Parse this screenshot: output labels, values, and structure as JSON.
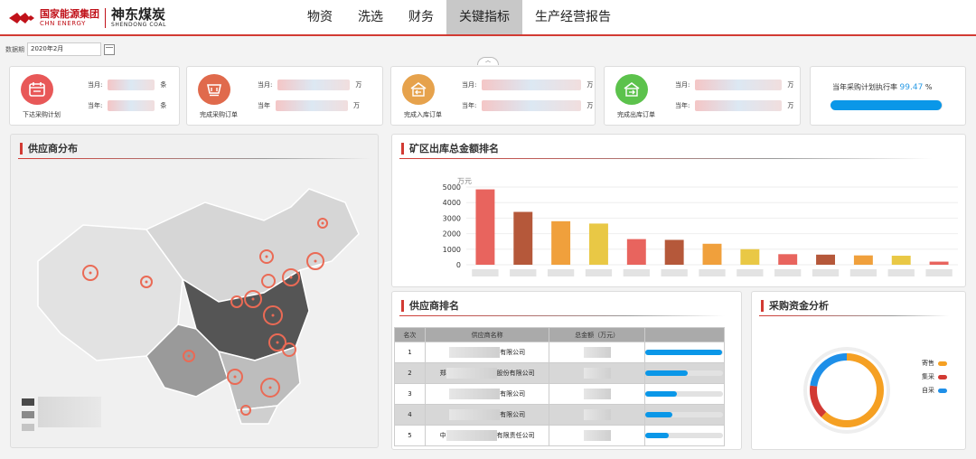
{
  "brand": {
    "cn1": "国家能源集团",
    "en1": "CHN ENERGY",
    "cn2": "神东煤炭",
    "en2": "SHENDONG COAL"
  },
  "nav": [
    {
      "label": "物资",
      "active": false
    },
    {
      "label": "洗选",
      "active": false
    },
    {
      "label": "财务",
      "active": false
    },
    {
      "label": "关键指标",
      "active": true
    },
    {
      "label": "生产经营报告",
      "active": false
    }
  ],
  "date_filter": {
    "label": "数据期",
    "value": "2020年2月"
  },
  "kpis": [
    {
      "caption": "下达采购计划",
      "row1_label": "当月:",
      "row1_unit": "条",
      "row2_label": "当年:",
      "row2_unit": "条",
      "color": "#e85858",
      "icon": "calendar-icon"
    },
    {
      "caption": "完成采购订单",
      "row1_label": "当月:",
      "row1_unit": "万",
      "row2_label": "当年",
      "row2_unit": "万",
      "color": "#e06a4c",
      "icon": "cart-icon"
    },
    {
      "caption": "完成入库订单",
      "row1_label": "当月:",
      "row1_unit": "万",
      "row2_label": "当年:",
      "row2_unit": "万",
      "color": "#e6a24c",
      "icon": "warehouse-in-icon"
    },
    {
      "caption": "完成出库订单",
      "row1_label": "当月:",
      "row1_unit": "万",
      "row2_label": "当年:",
      "row2_unit": "万",
      "color": "#5cc24c",
      "icon": "warehouse-out-icon"
    }
  ],
  "rate": {
    "label": "当年采购计划执行率",
    "value": "99.47",
    "unit": "%",
    "fraction": 0.9947
  },
  "panels": {
    "supplier_map": "供应商分布",
    "mine_ranking": "矿区出库总金额排名",
    "supplier_ranking": "供应商排名",
    "fund_analysis": "采购资金分析"
  },
  "chart_data": {
    "type": "bar",
    "title": "矿区出库总金额排名",
    "ylabel": "万元",
    "ylim": [
      0,
      5000
    ],
    "yticks": [
      0,
      1000,
      2000,
      3000,
      4000,
      5000
    ],
    "values": [
      4850,
      3400,
      2800,
      2650,
      1650,
      1600,
      1350,
      1000,
      680,
      650,
      600,
      580,
      200
    ],
    "colors": [
      "#e8645e",
      "#b5583a",
      "#f0a03c",
      "#e9c845",
      "#e8645e",
      "#b5583a",
      "#f0a03c",
      "#e9c845",
      "#e8645e",
      "#b5583a",
      "#f0a03c",
      "#e9c845",
      "#e8645e"
    ],
    "grid": true
  },
  "supplier_table": {
    "headers": [
      "名次",
      "供应商名称",
      "总金额（万元）",
      ""
    ],
    "rows": [
      {
        "rank": "1",
        "name_suffix": "有限公司",
        "share": 0.98
      },
      {
        "rank": "2",
        "name_prefix": "郑",
        "name_suffix": "股份有限公司",
        "share": 0.54
      },
      {
        "rank": "3",
        "name_suffix": "有限公司",
        "share": 0.4
      },
      {
        "rank": "4",
        "name_suffix": "有限公司",
        "share": 0.34
      },
      {
        "rank": "5",
        "name_prefix": "中",
        "name_suffix": "有限责任公司",
        "share": 0.3
      }
    ]
  },
  "fund_donut": {
    "segments": [
      {
        "label": "寄售",
        "value": 62,
        "color": "#f5a023"
      },
      {
        "label": "集采",
        "value": 15,
        "color": "#d23a33"
      },
      {
        "label": "自采",
        "value": 23,
        "color": "#1e8fe8"
      }
    ]
  },
  "map_legend": [
    {
      "color": "#4a4a4a"
    },
    {
      "color": "#8a8a8a"
    },
    {
      "color": "#c4c4c4"
    }
  ]
}
